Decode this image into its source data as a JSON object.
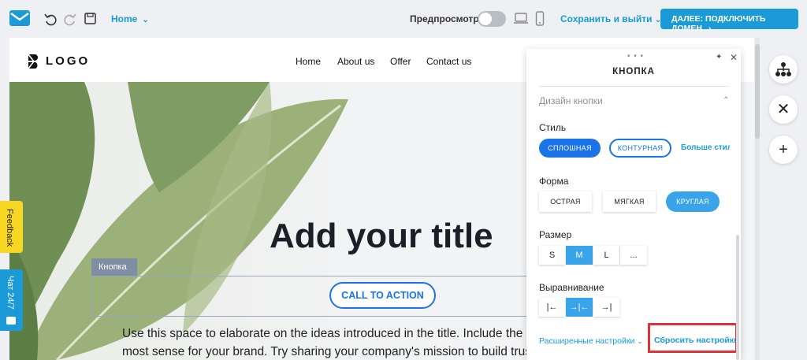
{
  "topbar": {
    "page_select": "Home",
    "preview_label": "Предпросмотр",
    "save_exit": "Сохранить и выйти",
    "next_button": "ДАЛЕЕ: ПОДКЛЮЧИТЬ ДОМЕН",
    "preview_enabled": false
  },
  "site": {
    "logo": "LOGO",
    "nav": [
      "Home",
      "About us",
      "Offer",
      "Contact us"
    ],
    "hero_title": "Add your title",
    "button_tag": "Кнопка",
    "cta": "CALL TO ACTION",
    "body_line1": "Use this space to elaborate on the ideas introduced in the title. Include the inform",
    "body_line2": "most sense for your brand. Try sharing your company's mission to build trust. Or, l"
  },
  "side_tabs": {
    "feedback": "Feedback",
    "chat": "Чат 24/7"
  },
  "panel": {
    "title": "КНОПКА",
    "section": "Дизайн кнопки",
    "style_label": "Стиль",
    "style_options": [
      "СПЛОШНАЯ",
      "КОНТУРНАЯ"
    ],
    "style_selected": "СПЛОШНАЯ",
    "more_styles": "Больше стилей",
    "shape_label": "Форма",
    "shape_options": [
      "ОСТРАЯ",
      "МЯГКАЯ",
      "КРУГЛАЯ"
    ],
    "shape_selected": "КРУГЛАЯ",
    "size_label": "Размер",
    "size_options": [
      "S",
      "M",
      "L",
      "..."
    ],
    "size_selected": "M",
    "align_label": "Выравнивание",
    "align_options": [
      "|←",
      "→|←",
      "→|"
    ],
    "align_selected": "→|←",
    "advanced": "Расширенные настройки",
    "reset": "Сбросить настройки"
  },
  "colors": {
    "accent": "#1a9bd7",
    "button_blue": "#1a73e8",
    "highlight": "#e0323a",
    "feedback": "#f8d723"
  },
  "icons": [
    "envelope-logo-icon",
    "undo-icon",
    "redo-icon",
    "save-icon",
    "desktop-icon",
    "mobile-icon",
    "sitemap-icon",
    "close-icon",
    "plus-icon"
  ]
}
